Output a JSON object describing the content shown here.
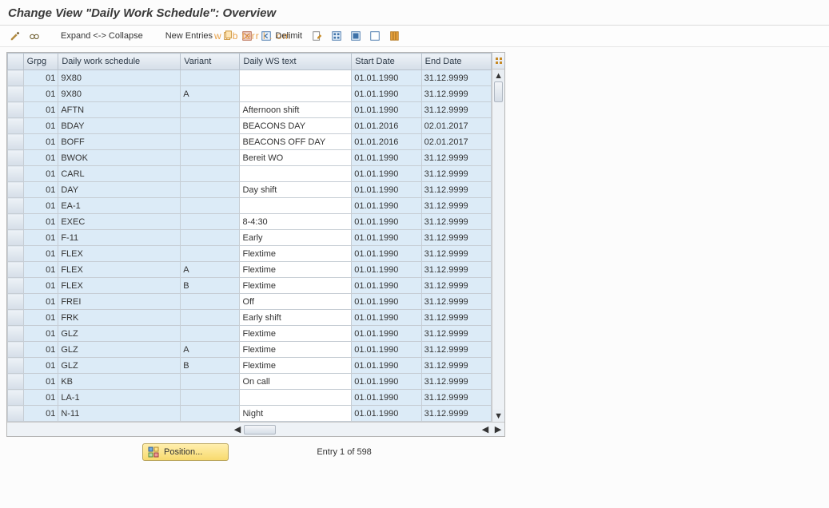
{
  "title": "Change View \"Daily Work Schedule\": Overview",
  "toolbar": {
    "expand_collapse": "Expand <-> Collapse",
    "new_entries": "New Entries",
    "delimit": "Delimit"
  },
  "watermark": "w . b terr l . om",
  "table": {
    "headers": {
      "grpg": "Grpg",
      "dws": "Daily work schedule",
      "variant": "Variant",
      "text": "Daily WS text",
      "start": "Start Date",
      "end": "End Date"
    },
    "rows": [
      {
        "grpg": "01",
        "dws": "9X80",
        "variant": "",
        "text": "",
        "start": "01.01.1990",
        "end": "31.12.9999"
      },
      {
        "grpg": "01",
        "dws": "9X80",
        "variant": "A",
        "text": "",
        "start": "01.01.1990",
        "end": "31.12.9999"
      },
      {
        "grpg": "01",
        "dws": "AFTN",
        "variant": "",
        "text": "Afternoon shift",
        "start": "01.01.1990",
        "end": "31.12.9999"
      },
      {
        "grpg": "01",
        "dws": "BDAY",
        "variant": "",
        "text": "BEACONS DAY",
        "start": "01.01.2016",
        "end": "02.01.2017"
      },
      {
        "grpg": "01",
        "dws": "BOFF",
        "variant": "",
        "text": "BEACONS OFF DAY",
        "start": "01.01.2016",
        "end": "02.01.2017"
      },
      {
        "grpg": "01",
        "dws": "BWOK",
        "variant": "",
        "text": "Bereit WO",
        "start": "01.01.1990",
        "end": "31.12.9999"
      },
      {
        "grpg": "01",
        "dws": "CARL",
        "variant": "",
        "text": "",
        "start": "01.01.1990",
        "end": "31.12.9999"
      },
      {
        "grpg": "01",
        "dws": "DAY",
        "variant": "",
        "text": "Day shift",
        "start": "01.01.1990",
        "end": "31.12.9999"
      },
      {
        "grpg": "01",
        "dws": "EA-1",
        "variant": "",
        "text": "",
        "start": "01.01.1990",
        "end": "31.12.9999"
      },
      {
        "grpg": "01",
        "dws": "EXEC",
        "variant": "",
        "text": "8-4:30",
        "start": "01.01.1990",
        "end": "31.12.9999"
      },
      {
        "grpg": "01",
        "dws": "F-11",
        "variant": "",
        "text": "Early",
        "start": "01.01.1990",
        "end": "31.12.9999"
      },
      {
        "grpg": "01",
        "dws": "FLEX",
        "variant": "",
        "text": "Flextime",
        "start": "01.01.1990",
        "end": "31.12.9999"
      },
      {
        "grpg": "01",
        "dws": "FLEX",
        "variant": "A",
        "text": "Flextime",
        "start": "01.01.1990",
        "end": "31.12.9999"
      },
      {
        "grpg": "01",
        "dws": "FLEX",
        "variant": "B",
        "text": "Flextime",
        "start": "01.01.1990",
        "end": "31.12.9999"
      },
      {
        "grpg": "01",
        "dws": "FREI",
        "variant": "",
        "text": "Off",
        "start": "01.01.1990",
        "end": "31.12.9999"
      },
      {
        "grpg": "01",
        "dws": "FRK",
        "variant": "",
        "text": "Early shift",
        "start": "01.01.1990",
        "end": "31.12.9999"
      },
      {
        "grpg": "01",
        "dws": "GLZ",
        "variant": "",
        "text": "Flextime",
        "start": "01.01.1990",
        "end": "31.12.9999"
      },
      {
        "grpg": "01",
        "dws": "GLZ",
        "variant": "A",
        "text": "Flextime",
        "start": "01.01.1990",
        "end": "31.12.9999"
      },
      {
        "grpg": "01",
        "dws": "GLZ",
        "variant": "B",
        "text": "Flextime",
        "start": "01.01.1990",
        "end": "31.12.9999"
      },
      {
        "grpg": "01",
        "dws": "KB",
        "variant": "",
        "text": "On call",
        "start": "01.01.1990",
        "end": "31.12.9999"
      },
      {
        "grpg": "01",
        "dws": "LA-1",
        "variant": "",
        "text": "",
        "start": "01.01.1990",
        "end": "31.12.9999"
      },
      {
        "grpg": "01",
        "dws": "N-11",
        "variant": "",
        "text": "Night",
        "start": "01.01.1990",
        "end": "31.12.9999"
      }
    ]
  },
  "footer": {
    "position_label": "Position...",
    "entry_status": "Entry 1 of 598"
  }
}
